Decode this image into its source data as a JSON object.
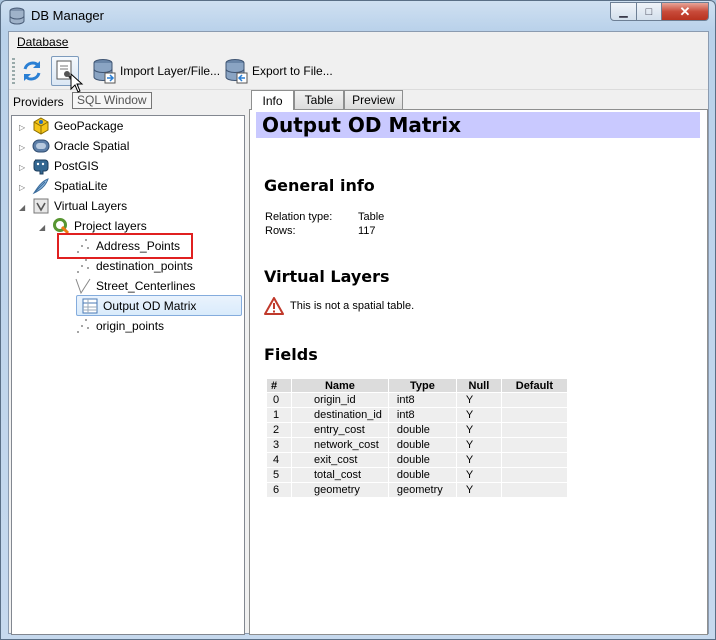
{
  "window": {
    "title": "DB Manager"
  },
  "menu": {
    "database": "Database"
  },
  "toolbar": {
    "sql_window_tooltip": "SQL Window",
    "import_label": "Import Layer/File...",
    "export_label": "Export to File..."
  },
  "providers": {
    "label": "Providers",
    "items": [
      {
        "label": "GeoPackage",
        "icon": "geopackage-icon"
      },
      {
        "label": "Oracle Spatial",
        "icon": "oracle-icon"
      },
      {
        "label": "PostGIS",
        "icon": "postgis-elephant-icon"
      },
      {
        "label": "SpatiaLite",
        "icon": "spatialite-feather-icon"
      },
      {
        "label": "Virtual Layers",
        "icon": "virtual-layers-icon"
      }
    ],
    "project_layers": "Project layers",
    "layers": [
      {
        "label": "Address_Points",
        "icon": "point-layer-icon"
      },
      {
        "label": "destination_points",
        "icon": "point-layer-icon"
      },
      {
        "label": "Street_Centerlines",
        "icon": "line-layer-icon"
      },
      {
        "label": "Output OD Matrix",
        "icon": "table-layer-icon"
      },
      {
        "label": "origin_points",
        "icon": "point-layer-icon"
      }
    ]
  },
  "tabs": [
    "Info",
    "Table",
    "Preview"
  ],
  "info": {
    "title": "Output OD Matrix",
    "general_heading": "General info",
    "relation_type_label": "Relation type:",
    "relation_type_value": "Table",
    "rows_label": "Rows:",
    "rows_value": "117",
    "virtual_heading": "Virtual Layers",
    "warning": "This is not a spatial table.",
    "fields_heading": "Fields",
    "field_columns": [
      "#",
      "Name",
      "Type",
      "Null",
      "Default"
    ],
    "fields": [
      [
        "0",
        "origin_id",
        "int8",
        "Y",
        ""
      ],
      [
        "1",
        "destination_id",
        "int8",
        "Y",
        ""
      ],
      [
        "2",
        "entry_cost",
        "double",
        "Y",
        ""
      ],
      [
        "3",
        "network_cost",
        "double",
        "Y",
        ""
      ],
      [
        "4",
        "exit_cost",
        "double",
        "Y",
        ""
      ],
      [
        "5",
        "total_cost",
        "double",
        "Y",
        ""
      ],
      [
        "6",
        "geometry",
        "geometry",
        "Y",
        ""
      ]
    ]
  }
}
